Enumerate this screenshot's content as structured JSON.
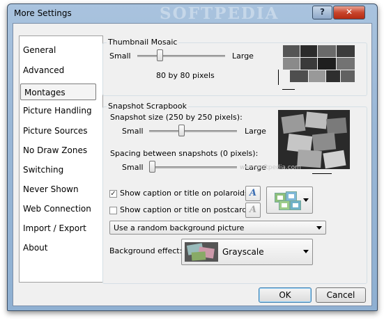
{
  "window": {
    "title": "More Settings",
    "watermark": "SOFTPEDIA",
    "help_label": "?",
    "close_label": "✕"
  },
  "sidebar": {
    "items": [
      {
        "label": "General"
      },
      {
        "label": "Advanced"
      },
      {
        "label": "Montages",
        "selected": true
      },
      {
        "label": "Picture Handling"
      },
      {
        "label": "Picture Sources"
      },
      {
        "label": "No Draw Zones"
      },
      {
        "label": "Switching"
      },
      {
        "label": "Never Shown"
      },
      {
        "label": "Web Connection"
      },
      {
        "label": "Import / Export"
      },
      {
        "label": "About"
      }
    ]
  },
  "thumbnail_mosaic": {
    "title": "Thumbnail Mosaic",
    "min_label": "Small",
    "max_label": "Large",
    "value_text": "80 by 80 pixels",
    "slider_level": 0.24
  },
  "snapshot_scrapbook": {
    "title": "Snapshot Scrapbook",
    "size_label": "Snapshot size (250 by 250 pixels):",
    "size_min": "Small",
    "size_max": "Large",
    "size_level": 0.36,
    "spacing_label": "Spacing between snapshots (0 pixels):",
    "spacing_min": "Small",
    "spacing_max": "Large",
    "spacing_level": 0.0,
    "caption_polaroids": {
      "label": "Show caption or title on polaroids",
      "checked": true
    },
    "caption_postcards": {
      "label": "Show caption or title on postcards",
      "checked": false
    },
    "font_button_glyph": "A",
    "background_select": "Use a random background picture",
    "background_effect_label": "Background effect:",
    "background_effect_value": "Grayscale",
    "watermark_url": "www.softpedia.com"
  },
  "buttons": {
    "ok": "OK",
    "cancel": "Cancel"
  },
  "colors": {
    "title_bar": "#9ab7d6",
    "close_button": "#c8452c",
    "dialog_bg": "#f0f0f0"
  }
}
